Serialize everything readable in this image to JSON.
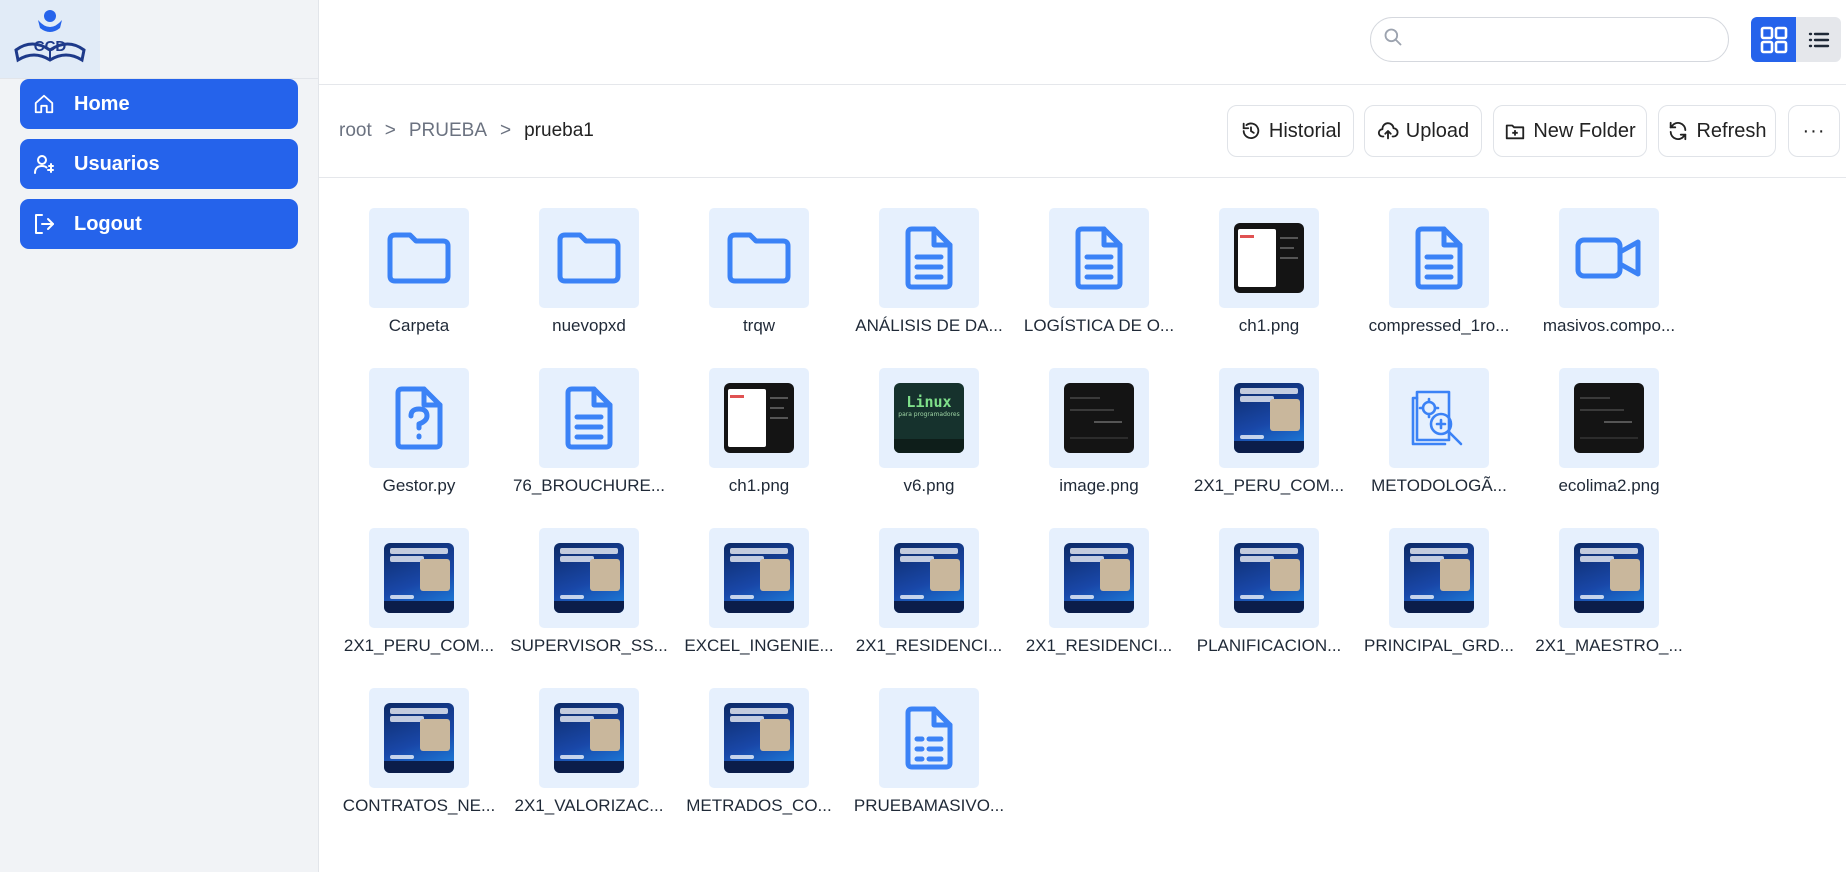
{
  "app": {
    "logo_text": "CCD"
  },
  "sidebar": {
    "items": [
      {
        "label": "Home",
        "icon": "home-icon"
      },
      {
        "label": "Usuarios",
        "icon": "users-icon"
      },
      {
        "label": "Logout",
        "icon": "logout-icon"
      }
    ]
  },
  "header": {
    "search": {
      "placeholder": "",
      "value": ""
    },
    "view_modes": [
      "grid",
      "list"
    ],
    "active_view": "grid"
  },
  "breadcrumb": {
    "items": [
      "root",
      "PRUEBA",
      "prueba1"
    ],
    "separator": ">"
  },
  "toolbar": {
    "historial_label": "Historial",
    "upload_label": "Upload",
    "new_folder_label": "New Folder",
    "refresh_label": "Refresh",
    "more_label": "···"
  },
  "colors": {
    "accent": "#2563eb",
    "icon_tile": "#e6f0fd",
    "icon_stroke": "#3b82f6"
  },
  "files": [
    {
      "name": "Carpeta",
      "kind": "folder"
    },
    {
      "name": "nuevopxd",
      "kind": "folder"
    },
    {
      "name": "trqw",
      "kind": "folder"
    },
    {
      "name": "ANÁLISIS DE DA...",
      "kind": "document"
    },
    {
      "name": "LOGÍSTICA DE O...",
      "kind": "document"
    },
    {
      "name": "ch1.png",
      "kind": "image-screenshot"
    },
    {
      "name": "compressed_1ro...",
      "kind": "document"
    },
    {
      "name": "masivos.compo...",
      "kind": "video"
    },
    {
      "name": "Gestor.py",
      "kind": "unknown"
    },
    {
      "name": "76_BROUCHURE...",
      "kind": "document"
    },
    {
      "name": "ch1.png",
      "kind": "image-screenshot"
    },
    {
      "name": "v6.png",
      "kind": "image-linux"
    },
    {
      "name": "image.png",
      "kind": "image-dark"
    },
    {
      "name": "2X1_PERU_COM...",
      "kind": "image-promo"
    },
    {
      "name": "METODOLOGÃ...",
      "kind": "methodology"
    },
    {
      "name": "ecolima2.png",
      "kind": "image-dark"
    },
    {
      "name": "2X1_PERU_COM...",
      "kind": "image-promo"
    },
    {
      "name": "SUPERVISOR_SS...",
      "kind": "image-promo"
    },
    {
      "name": "EXCEL_INGENIE...",
      "kind": "image-promo"
    },
    {
      "name": "2X1_RESIDENCI...",
      "kind": "image-promo"
    },
    {
      "name": "2X1_RESIDENCI...",
      "kind": "image-promo"
    },
    {
      "name": "PLANIFICACION...",
      "kind": "image-promo"
    },
    {
      "name": "PRINCIPAL_GRD...",
      "kind": "image-promo"
    },
    {
      "name": "2X1_MAESTRO_...",
      "kind": "image-promo"
    },
    {
      "name": "CONTRATOS_NE...",
      "kind": "image-promo"
    },
    {
      "name": "2X1_VALORIZAC...",
      "kind": "image-promo"
    },
    {
      "name": "METRADOS_CO...",
      "kind": "image-promo"
    },
    {
      "name": "PRUEBAMASIVO...",
      "kind": "spreadsheet"
    }
  ]
}
